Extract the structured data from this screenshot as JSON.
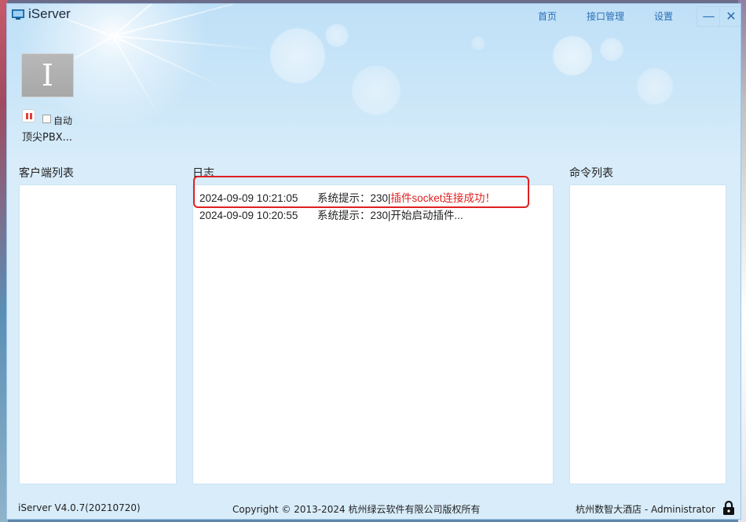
{
  "window": {
    "title": "iServer"
  },
  "nav": {
    "home": "首页",
    "api": "接口管理",
    "settings": "设置"
  },
  "controls": {
    "minimize": "—",
    "close": "✕"
  },
  "plugin": {
    "tile_letter": "I",
    "auto_label": "自动",
    "auto_checked": false,
    "name": "顶尖PBX..."
  },
  "panels": {
    "clients_title": "客户端列表",
    "log_title": "日志",
    "commands_title": "命令列表"
  },
  "log": [
    {
      "time": "2024-09-09 10:21:05",
      "prefix": "系统提示：230|",
      "message": "插件socket连接成功！",
      "highlight": true
    },
    {
      "time": "2024-09-09 10:20:55",
      "prefix": "系统提示：230|",
      "message": "开始启动插件...",
      "highlight": false
    }
  ],
  "status": {
    "version": "iServer V4.0.7(20210720)",
    "copyright": "Copyright © 2013-2024 杭州绿云软件有限公司版权所有",
    "user": "杭州数智大酒店 - Administrator"
  },
  "colors": {
    "accent": "#2a6fb4",
    "error": "#e02020",
    "background": "#d8ecfa"
  }
}
